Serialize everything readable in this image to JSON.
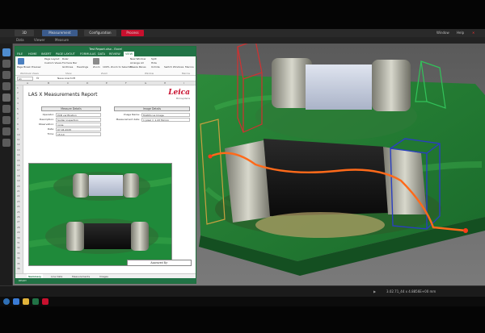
{
  "las": {
    "tabs": [
      "3D",
      "Measurement",
      "Configuration",
      "Process"
    ],
    "win_controls": [
      "Window",
      "Help"
    ],
    "sub_items": [
      "Data",
      "Viewer",
      "Measure"
    ],
    "status": "3.02.71_44 x 4.8856E+00 mm",
    "colors": {
      "accent_red": "#c8102e",
      "tab_blue": "#3b5b8c"
    }
  },
  "excel": {
    "title": "Test Report.xlsx - Excel",
    "ribbon_tabs": [
      "FILE",
      "HOME",
      "INSERT",
      "PAGE LAYOUT",
      "FORMULAS",
      "DATA",
      "REVIEW",
      "VIEW"
    ],
    "active_ribbon_tab": "VIEW",
    "ribbon_items": [
      "Page Break Preview",
      "Page Layout",
      "Custom Views",
      "Ruler",
      "Formula Bar",
      "Gridlines",
      "Headings",
      "Zoom",
      "100%",
      "Zoom to Selection",
      "New Window",
      "Arrange All",
      "Freeze Panes",
      "Split",
      "Hide",
      "Unhide",
      "Switch Windows",
      "Macros"
    ],
    "ribbon_groups": [
      "Workbook Views",
      "Show",
      "Zoom",
      "Window",
      "Macros"
    ],
    "name_box": "A1",
    "formula_value": "Neue Anschrift",
    "columns": [
      "A",
      "B",
      "C",
      "D",
      "E",
      "F",
      "G",
      "H",
      "I"
    ],
    "rows": [
      "1",
      "2",
      "3",
      "4",
      "5",
      "6",
      "7",
      "8",
      "9",
      "10",
      "11",
      "12",
      "13",
      "14",
      "15",
      "16",
      "17",
      "18",
      "19",
      "20",
      "21",
      "22",
      "23",
      "24",
      "25",
      "26",
      "27",
      "28",
      "29",
      "30",
      "31",
      "32",
      "33",
      "34",
      "35",
      "36"
    ],
    "sheets": [
      "Summary",
      "Line Data",
      "Measurements",
      "Images"
    ],
    "active_sheet": "Summary",
    "status_left": "READY"
  },
  "report": {
    "title": "LAS X Measurements Report",
    "logo": "Leica",
    "logo_sub": "Microsystems",
    "measure_header": "Measure Details",
    "image_header": "Image Details",
    "fields": [
      {
        "key": "Operator:",
        "value": "PCB verification"
      },
      {
        "key": "Description:",
        "value": "Solder inspection"
      },
      {
        "key": "Observation:",
        "value": "none"
      },
      {
        "key": "Date:",
        "value": "07.04.2015"
      },
      {
        "key": "Time:",
        "value": "15:14"
      }
    ],
    "image_fields": [
      {
        "key": "Image Name:",
        "value": "Multifocus Image"
      },
      {
        "key": "Measurement data:",
        "value": "1 pixel = 1.43 Micron"
      }
    ],
    "approved_by": "Approved By:"
  }
}
